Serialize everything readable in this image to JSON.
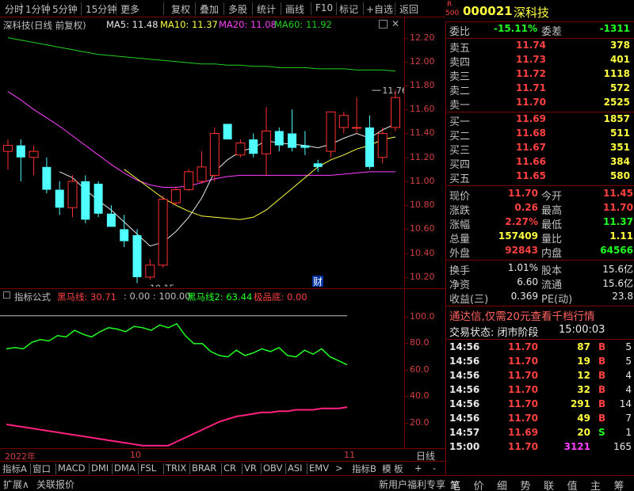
{
  "toolbar": {
    "items": [
      "分时",
      "1分钟",
      "5分钟",
      "15分钟",
      "更多",
      "复权",
      "叠加",
      "多股",
      "统计",
      "画线",
      "F10",
      "标记",
      "+自选",
      "返回"
    ]
  },
  "stock": {
    "badge_r": "R",
    "badge_num": "500",
    "code": "000021",
    "name": "深科技"
  },
  "main_chart": {
    "title": "深科技(日线 前复权)",
    "ma5_label": "MA5: 11.48",
    "ma10_label": "MA10: 11.37",
    "ma20_label": "MA20: 11.08",
    "ma60_label": "MA60: 11.92",
    "high_annotation": "11.76",
    "low_annotation": "10.15",
    "finance_marker": "财"
  },
  "colors": {
    "up": "#ff3030",
    "down": "#50ffff",
    "ma5": "#e8e8e8",
    "ma10": "#ffff40",
    "ma20": "#ff40ff",
    "ma60": "#20d020",
    "bg": "#000000",
    "grid": "#7a0000"
  },
  "chart_data": [
    {
      "type": "candlestick",
      "title": "深科技(日线 前复权)",
      "y_ticks": [
        12.2,
        12.0,
        11.8,
        11.6,
        11.4,
        11.2,
        11.0,
        10.8,
        10.6,
        10.4,
        10.2
      ],
      "ylim": [
        10.12,
        12.25
      ],
      "candles": [
        {
          "o": 11.25,
          "h": 11.35,
          "l": 11.1,
          "c": 11.3
        },
        {
          "o": 11.3,
          "h": 11.35,
          "l": 11.0,
          "c": 11.2
        },
        {
          "o": 11.2,
          "h": 11.3,
          "l": 11.05,
          "c": 11.25
        },
        {
          "o": 11.12,
          "h": 11.2,
          "l": 10.9,
          "c": 10.93
        },
        {
          "o": 10.93,
          "h": 11.0,
          "l": 10.72,
          "c": 10.78
        },
        {
          "o": 10.78,
          "h": 11.05,
          "l": 10.7,
          "c": 11.0
        },
        {
          "o": 11.0,
          "h": 11.05,
          "l": 10.65,
          "c": 10.68
        },
        {
          "o": 10.98,
          "h": 11.0,
          "l": 10.7,
          "c": 10.73
        },
        {
          "o": 10.73,
          "h": 10.8,
          "l": 10.62,
          "c": 10.62
        },
        {
          "o": 10.6,
          "h": 10.72,
          "l": 10.45,
          "c": 10.5
        },
        {
          "o": 10.55,
          "h": 10.6,
          "l": 10.15,
          "c": 10.2
        },
        {
          "o": 10.2,
          "h": 10.35,
          "l": 10.18,
          "c": 10.3
        },
        {
          "o": 10.3,
          "h": 10.88,
          "l": 10.28,
          "c": 10.85
        },
        {
          "o": 10.82,
          "h": 10.95,
          "l": 10.8,
          "c": 10.93
        },
        {
          "o": 10.93,
          "h": 11.1,
          "l": 10.92,
          "c": 11.08
        },
        {
          "o": 11.0,
          "h": 11.25,
          "l": 10.98,
          "c": 11.12
        },
        {
          "o": 11.05,
          "h": 11.45,
          "l": 11.0,
          "c": 11.4
        },
        {
          "o": 11.48,
          "h": 11.48,
          "l": 11.35,
          "c": 11.35
        },
        {
          "o": 11.22,
          "h": 11.35,
          "l": 11.2,
          "c": 11.32
        },
        {
          "o": 11.35,
          "h": 11.4,
          "l": 11.2,
          "c": 11.23
        },
        {
          "o": 11.23,
          "h": 11.62,
          "l": 11.05,
          "c": 11.42
        },
        {
          "o": 11.42,
          "h": 11.45,
          "l": 11.25,
          "c": 11.3
        },
        {
          "o": 11.4,
          "h": 11.6,
          "l": 11.25,
          "c": 11.28
        },
        {
          "o": 11.3,
          "h": 11.42,
          "l": 11.22,
          "c": 11.28
        },
        {
          "o": 11.15,
          "h": 11.18,
          "l": 11.08,
          "c": 11.12
        },
        {
          "o": 11.25,
          "h": 11.58,
          "l": 11.2,
          "c": 11.58
        },
        {
          "o": 11.45,
          "h": 11.58,
          "l": 11.4,
          "c": 11.55
        },
        {
          "o": 11.45,
          "h": 11.7,
          "l": 11.4,
          "c": 11.45
        },
        {
          "o": 11.45,
          "h": 11.55,
          "l": 11.1,
          "c": 11.12
        },
        {
          "o": 11.2,
          "h": 11.45,
          "l": 11.15,
          "c": 11.4
        },
        {
          "o": 11.45,
          "h": 11.76,
          "l": 11.42,
          "c": 11.7
        }
      ],
      "ma5": [
        null,
        null,
        null,
        null,
        11.08,
        11.03,
        10.93,
        10.84,
        10.76,
        10.66,
        10.56,
        10.46,
        10.49,
        10.58,
        10.7,
        10.86,
        11.08,
        11.18,
        11.25,
        11.28,
        11.34,
        11.32,
        11.31,
        11.3,
        11.28,
        11.31,
        11.36,
        11.4,
        11.36,
        11.43,
        11.48
      ],
      "ma10": [
        null,
        null,
        null,
        null,
        null,
        null,
        null,
        null,
        null,
        11.1,
        11.02,
        10.94,
        10.86,
        10.8,
        10.75,
        10.71,
        10.7,
        10.69,
        10.68,
        10.7,
        10.76,
        10.85,
        10.94,
        11.03,
        11.12,
        11.18,
        11.22,
        11.27,
        11.3,
        11.35,
        11.37
      ],
      "ma20": [
        11.75,
        11.68,
        11.6,
        11.53,
        11.46,
        11.38,
        11.3,
        11.22,
        11.14,
        11.07,
        11.01,
        10.97,
        10.95,
        10.95,
        10.96,
        10.99,
        11.02,
        11.04,
        11.05,
        11.05,
        11.05,
        11.05,
        11.05,
        11.05,
        11.05,
        11.05,
        11.06,
        11.07,
        11.08,
        11.08,
        11.08
      ],
      "ma60": [
        12.2,
        12.18,
        12.16,
        12.14,
        12.12,
        12.1,
        12.08,
        12.06,
        12.05,
        12.04,
        12.03,
        12.02,
        12.01,
        12.0,
        11.99,
        11.98,
        11.98,
        11.97,
        11.97,
        11.96,
        11.96,
        11.95,
        11.95,
        11.95,
        11.94,
        11.94,
        11.94,
        11.93,
        11.93,
        11.93,
        11.92
      ]
    },
    {
      "type": "line",
      "title": "指标公式",
      "y_ticks": [
        100,
        80,
        60,
        40,
        20
      ],
      "ylim": [
        0,
        110
      ],
      "series": [
        {
          "name": "黑马线",
          "values": [
            75,
            76,
            75,
            80,
            82,
            81,
            85,
            84,
            89,
            86,
            84,
            88,
            91,
            90,
            88,
            92,
            91,
            89,
            93,
            91,
            94,
            85,
            79,
            79,
            73,
            70,
            69,
            74,
            70,
            72,
            75,
            73,
            76,
            70,
            69,
            74,
            71,
            75,
            69,
            66,
            63
          ]
        },
        {
          "name": "黑马线2",
          "values": [
            18,
            17,
            16,
            15,
            14,
            13,
            12,
            11,
            10,
            9,
            8,
            7,
            6,
            5,
            4,
            3,
            2,
            2,
            2,
            2,
            5,
            8,
            11,
            14,
            17,
            20,
            22,
            24,
            25,
            26,
            27,
            27,
            28,
            28,
            29,
            29,
            29,
            30,
            30,
            30,
            31
          ]
        }
      ]
    }
  ],
  "indicator": {
    "title": "指标公式",
    "line1_label": "黑马线: 30.71",
    "param_label": ": 0.00 : 100.00",
    "line2_label": "黑马线2: 63.44",
    "extreme_label": "极品底: 0.00"
  },
  "date_bar": {
    "year_label": "2022年",
    "month_label": "10",
    "end_label": "11",
    "period": "日线"
  },
  "tabs": {
    "left_label": "指标A",
    "items": [
      "窗口",
      "MACD",
      "DMI",
      "DMA",
      "FSL",
      "TRIX",
      "BRAR",
      "CR",
      "VR",
      "OBV",
      "ASI",
      "EMV"
    ],
    "more_arrow": ">",
    "right_label": "指标B",
    "template": "模 板",
    "plus": "+",
    "minus": "-"
  },
  "status": {
    "expand": "扩展∧",
    "report": "关联报价",
    "promo": "新用户福利专享",
    "icons": [
      "笔",
      "价",
      "细",
      "势",
      "联",
      "值",
      "主",
      "筹"
    ]
  },
  "quote": {
    "weibi_label": "委比",
    "weibi_value": "-15.11%",
    "weicha_label": "委差",
    "weicha_value": "-1311",
    "asks": [
      {
        "label": "卖五",
        "price": "11.74",
        "vol": "378"
      },
      {
        "label": "卖四",
        "price": "11.73",
        "vol": "401"
      },
      {
        "label": "卖三",
        "price": "11.72",
        "vol": "1118"
      },
      {
        "label": "卖二",
        "price": "11.71",
        "vol": "572"
      },
      {
        "label": "卖一",
        "price": "11.70",
        "vol": "2525"
      }
    ],
    "bids": [
      {
        "label": "买一",
        "price": "11.69",
        "vol": "1857"
      },
      {
        "label": "买二",
        "price": "11.68",
        "vol": "511"
      },
      {
        "label": "买三",
        "price": "11.67",
        "vol": "351"
      },
      {
        "label": "买四",
        "price": "11.66",
        "vol": "384"
      },
      {
        "label": "买五",
        "price": "11.65",
        "vol": "580"
      }
    ],
    "stats": [
      {
        "l1": "现价",
        "v1": "11.70",
        "c1": "red",
        "l2": "今开",
        "v2": "11.45",
        "c2": "red"
      },
      {
        "l1": "涨跌",
        "v1": "0.26",
        "c1": "red",
        "l2": "最高",
        "v2": "11.70",
        "c2": "red"
      },
      {
        "l1": "涨幅",
        "v1": "2.27%",
        "c1": "red",
        "l2": "最低",
        "v2": "11.37",
        "c2": "green"
      },
      {
        "l1": "总量",
        "v1": "157409",
        "c1": "yellow",
        "l2": "量比",
        "v2": "1.11",
        "c2": "yellow"
      },
      {
        "l1": "外盘",
        "v1": "92843",
        "c1": "red",
        "l2": "内盘",
        "v2": "64566",
        "c2": "green"
      }
    ],
    "stats2": [
      {
        "l1": "换手",
        "v1": "1.01%",
        "l2": "股本",
        "v2": "15.6亿"
      },
      {
        "l1": "净资",
        "v1": "6.60",
        "l2": "流通",
        "v2": "15.6亿"
      },
      {
        "l1": "收益(三)",
        "v1": "0.369",
        "l2": "PE(动)",
        "v2": "23.8"
      }
    ],
    "promo_line": "通达信,仅需20元查看千档行情",
    "trade_state_label": "交易状态: 闭市阶段",
    "trade_state_time": "15:00:03",
    "ticks": [
      {
        "t": "14:56",
        "p": "11.70",
        "v": "87",
        "s": "B",
        "n": "5"
      },
      {
        "t": "14:56",
        "p": "11.70",
        "v": "19",
        "s": "B",
        "n": "5"
      },
      {
        "t": "14:56",
        "p": "11.70",
        "v": "12",
        "s": "B",
        "n": "4"
      },
      {
        "t": "14:56",
        "p": "11.70",
        "v": "32",
        "s": "B",
        "n": "4"
      },
      {
        "t": "14:56",
        "p": "11.70",
        "v": "291",
        "s": "B",
        "n": "14"
      },
      {
        "t": "14:56",
        "p": "11.70",
        "v": "49",
        "s": "B",
        "n": "7"
      },
      {
        "t": "14:57",
        "p": "11.69",
        "v": "20",
        "s": "S",
        "n": "1"
      },
      {
        "t": "15:00",
        "p": "11.70",
        "v": "3121",
        "s": "",
        "n": "165"
      }
    ]
  }
}
